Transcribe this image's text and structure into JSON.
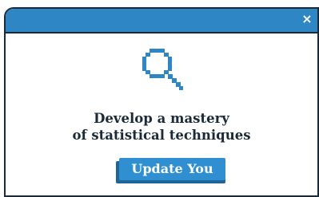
{
  "dialog": {
    "close_glyph": "×",
    "icon": "magnifying-glass-icon",
    "message_line1": "Develop a mastery",
    "message_line2": "of statistical techniques",
    "button_label": "Update You"
  },
  "colors": {
    "titlebar": "#2f86c4",
    "border": "#1b2a38",
    "button": "#2f8fd0",
    "button_shadow": "#1e6699",
    "text": "#1b2a38"
  }
}
